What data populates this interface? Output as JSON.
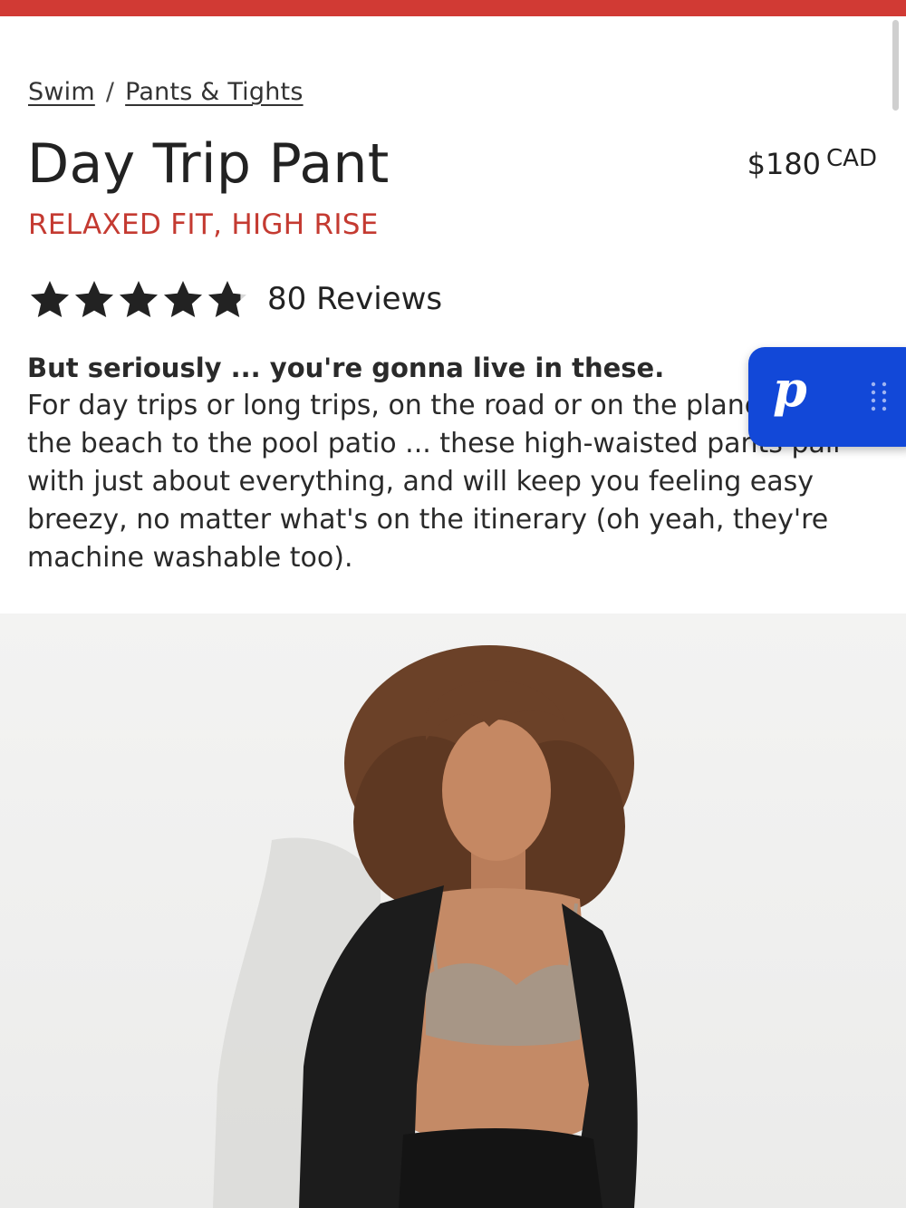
{
  "breadcrumb": {
    "items": [
      "Swim",
      "Pants & Tights"
    ],
    "separator": "/"
  },
  "product": {
    "title": "Day Trip Pant",
    "price": "$180",
    "currency": "CAD",
    "fit": "RELAXED FIT, HIGH RISE",
    "rating": 4.8,
    "rating_max": 5,
    "reviews_label": "80 Reviews",
    "description_lead": "But seriously ... you're gonna live in these.",
    "description_body": "For day trips or long trips, on the road or on the plane, from the beach to the pool patio ... these high-waisted pants pair with just about everything, and will keep you feeling easy breezy, no matter what's on the itinerary (oh yeah, they're machine washable too)."
  },
  "widget": {
    "logo_text": "p",
    "icon": "drag-handle-icon"
  },
  "colors": {
    "accent_red": "#d13a34",
    "fit_red": "#c43a31",
    "widget_blue": "#1248d8",
    "text": "#222222"
  },
  "hero_image": {
    "icon": "product-photo"
  }
}
